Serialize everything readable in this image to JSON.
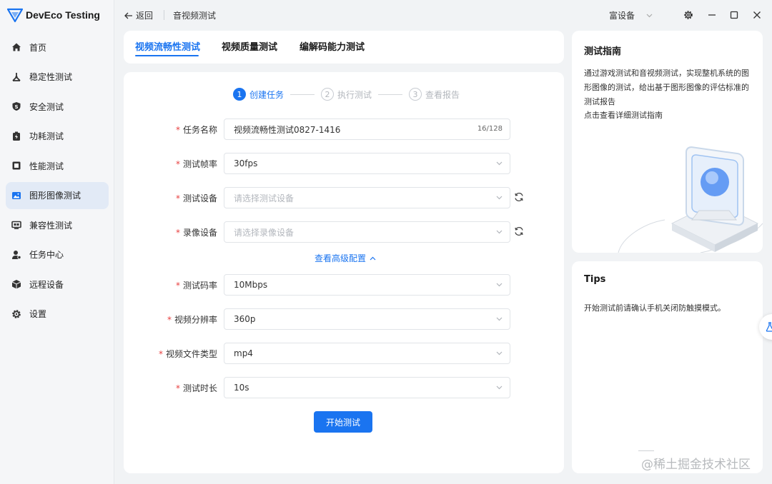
{
  "app": {
    "name": "DevEco Testing"
  },
  "sidebar": {
    "items": [
      {
        "label": "首页",
        "icon": "home-icon"
      },
      {
        "label": "稳定性测试",
        "icon": "stability-icon"
      },
      {
        "label": "安全测试",
        "icon": "shield-icon"
      },
      {
        "label": "功耗测试",
        "icon": "battery-icon"
      },
      {
        "label": "性能测试",
        "icon": "performance-icon"
      },
      {
        "label": "图形图像测试",
        "icon": "image-icon",
        "active": true
      },
      {
        "label": "兼容性测试",
        "icon": "compat-icon"
      },
      {
        "label": "任务中心",
        "icon": "task-icon"
      },
      {
        "label": "远程设备",
        "icon": "cube-icon"
      },
      {
        "label": "设置",
        "icon": "gear-icon"
      }
    ]
  },
  "topbar": {
    "back_label": "返回",
    "title": "音视频测试",
    "device_label": "富设备"
  },
  "tabs": [
    {
      "label": "视频流畅性测试",
      "active": true
    },
    {
      "label": "视频质量测试"
    },
    {
      "label": "编解码能力测试"
    }
  ],
  "steps": [
    {
      "num": "1",
      "label": "创建任务",
      "active": true
    },
    {
      "num": "2",
      "label": "执行测试"
    },
    {
      "num": "3",
      "label": "查看报告"
    }
  ],
  "form": {
    "task_name": {
      "label": "任务名称",
      "value": "视频流畅性测试0827-1416",
      "count": "16/128"
    },
    "frame_rate": {
      "label": "测试帧率",
      "value": "30fps"
    },
    "test_device": {
      "label": "测试设备",
      "placeholder": "请选择测试设备"
    },
    "record_device": {
      "label": "录像设备",
      "placeholder": "请选择录像设备"
    },
    "advanced_label": "查看高级配置",
    "bitrate": {
      "label": "测试码率",
      "value": "10Mbps"
    },
    "resolution": {
      "label": "视频分辨率",
      "value": "360p"
    },
    "file_type": {
      "label": "视频文件类型",
      "value": "mp4"
    },
    "duration": {
      "label": "测试时长",
      "value": "10s"
    },
    "start_label": "开始测试"
  },
  "guide": {
    "title": "测试指南",
    "text": "通过游戏测试和音视频测试，实现整机系统的图形图像的测试，给出基于图形图像的评估标准的测试报告",
    "link": "点击查看详细测试指南"
  },
  "tips": {
    "title": "Tips",
    "text": "开始测试前请确认手机关闭防触摸模式。"
  },
  "watermark": "@稀土掘金技术社区",
  "colors": {
    "accent": "#1a74f0",
    "required": "#e84040",
    "active_nav_bg": "#e2eaf6"
  }
}
